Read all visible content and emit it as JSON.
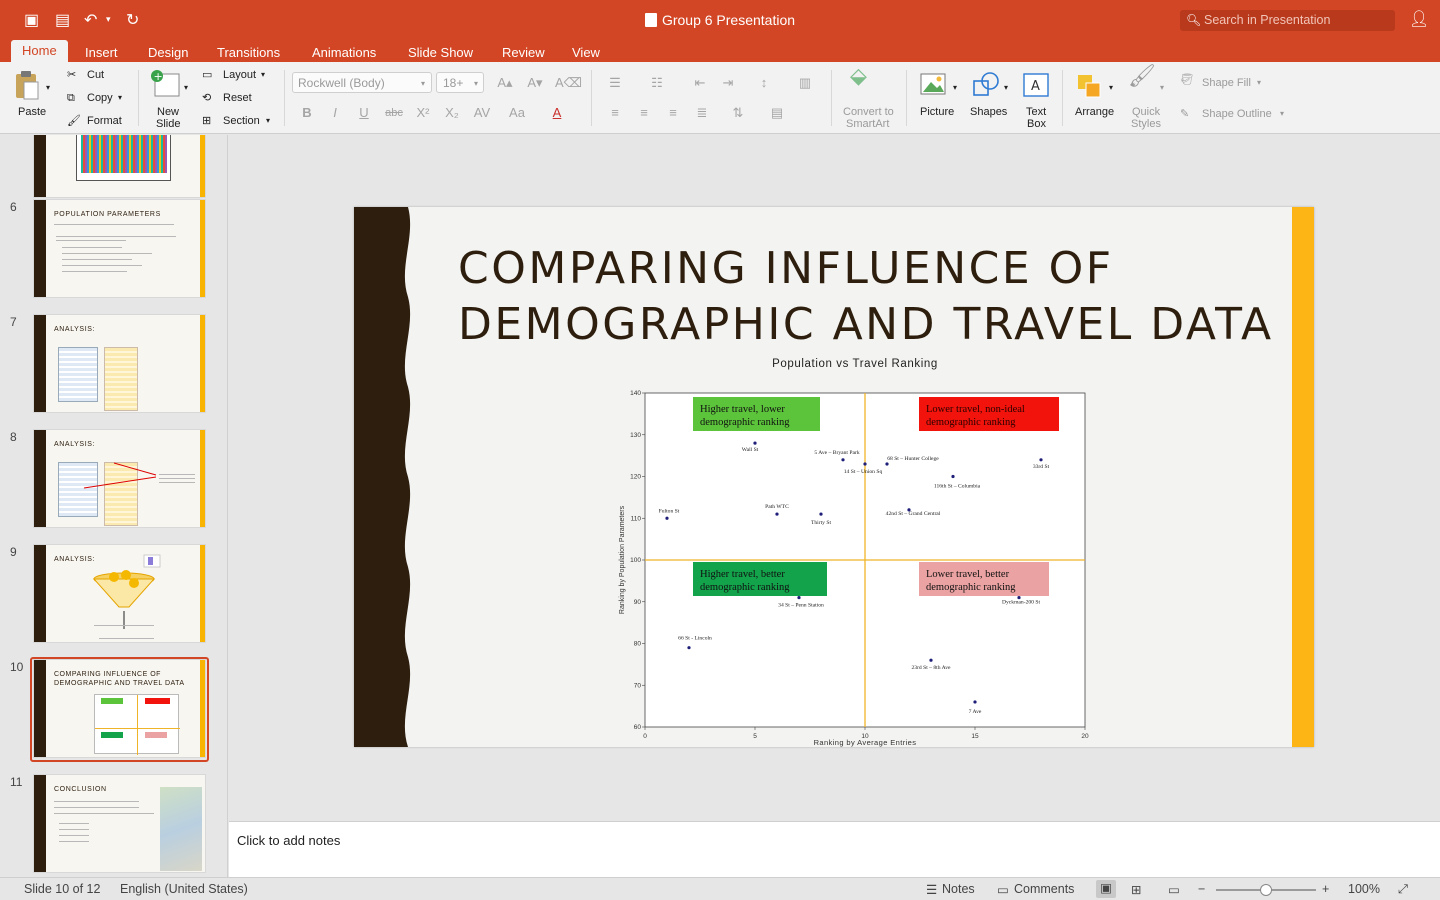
{
  "app": {
    "title": "Group 6 Presentation",
    "search_placeholder": "Search in Presentation"
  },
  "tabs": [
    "Home",
    "Insert",
    "Design",
    "Transitions",
    "Animations",
    "Slide Show",
    "Review",
    "View"
  ],
  "active_tab": "Home",
  "ribbon": {
    "paste": "Paste",
    "cut": "Cut",
    "copy": "Copy",
    "format": "Format",
    "new_slide_1": "New",
    "new_slide_2": "Slide",
    "layout": "Layout",
    "reset": "Reset",
    "section": "Section",
    "font_name": "Rockwell (Body)",
    "font_size": "18+",
    "smartart_1": "Convert to",
    "smartart_2": "SmartArt",
    "picture": "Picture",
    "shapes": "Shapes",
    "textbox_1": "Text",
    "textbox_2": "Box",
    "arrange": "Arrange",
    "quick_styles_1": "Quick",
    "quick_styles_2": "Styles",
    "shape_fill": "Shape Fill",
    "shape_outline": "Shape Outline"
  },
  "thumbnails": [
    {
      "num": "",
      "title": ""
    },
    {
      "num": "6",
      "title": "POPULATION PARAMETERS"
    },
    {
      "num": "7",
      "title": "ANALYSIS:"
    },
    {
      "num": "8",
      "title": "ANALYSIS:"
    },
    {
      "num": "9",
      "title": "ANALYSIS:"
    },
    {
      "num": "10",
      "title": "COMPARING INFLUENCE OF DEMOGRAPHIC AND TRAVEL DATA"
    },
    {
      "num": "11",
      "title": "CONCLUSION"
    }
  ],
  "slide": {
    "title_line1": "COMPARING INFLUENCE OF",
    "title_line2": "DEMOGRAPHIC AND TRAVEL DATA"
  },
  "chart_data": {
    "type": "scatter",
    "title": "Population vs Travel Ranking",
    "xlabel": "Ranking by Average Entries",
    "ylabel": "Ranking by Population Parameters",
    "xlim": [
      0,
      20
    ],
    "ylim": [
      60,
      140
    ],
    "xticks": [
      0,
      5,
      10,
      15,
      20
    ],
    "yticks": [
      60,
      70,
      80,
      90,
      100,
      110,
      120,
      130,
      140
    ],
    "reference_lines": {
      "x": 10,
      "y": 100
    },
    "colors": {
      "line": "#f0b429",
      "point": "#1f1f7a"
    },
    "points": [
      {
        "label": "Fulton St",
        "x": 1,
        "y": 110
      },
      {
        "label": "Wall St",
        "x": 5,
        "y": 128
      },
      {
        "label": "5 Ave – Bryant Park",
        "x": 9,
        "y": 124
      },
      {
        "label": "14 St – Union Sq",
        "x": 10,
        "y": 123
      },
      {
        "label": "68 St – Hunter College",
        "x": 11,
        "y": 123
      },
      {
        "label": "116th St – Columbia",
        "x": 14,
        "y": 120
      },
      {
        "label": "33rd St",
        "x": 18,
        "y": 124
      },
      {
        "label": "Path WTC",
        "x": 6,
        "y": 111
      },
      {
        "label": "Thirty St",
        "x": 8,
        "y": 111
      },
      {
        "label": "42nd St – Grand Central",
        "x": 12,
        "y": 112
      },
      {
        "label": "34 St – Penn Station",
        "x": 7,
        "y": 91
      },
      {
        "label": "Dyckman-200 St",
        "x": 17,
        "y": 91
      },
      {
        "label": "66 St - Lincoln",
        "x": 2,
        "y": 79
      },
      {
        "label": "23rd St – 8th Ave",
        "x": 13,
        "y": 76
      },
      {
        "label": "7 Ave",
        "x": 15,
        "y": 66
      }
    ],
    "annotations": [
      {
        "line1": "Higher travel, lower",
        "line2": "demographic ranking",
        "color": "#5cc43b",
        "text_color": "#111111"
      },
      {
        "line1": "Lower travel, non-ideal",
        "line2": "demographic ranking",
        "color": "#f2140c",
        "text_color": "#2a0000"
      },
      {
        "line1": "Higher travel, better",
        "line2": "demographic ranking",
        "color": "#12a34b",
        "text_color": "#111111"
      },
      {
        "line1": "Lower travel, better",
        "line2": "demographic ranking",
        "color": "#eaa2a2",
        "text_color": "#111111"
      }
    ]
  },
  "notes": {
    "placeholder": "Click to add notes"
  },
  "status": {
    "slide_counter": "Slide 10 of 12",
    "language": "English (United States)",
    "notes": "Notes",
    "comments": "Comments",
    "zoom": "100%"
  }
}
